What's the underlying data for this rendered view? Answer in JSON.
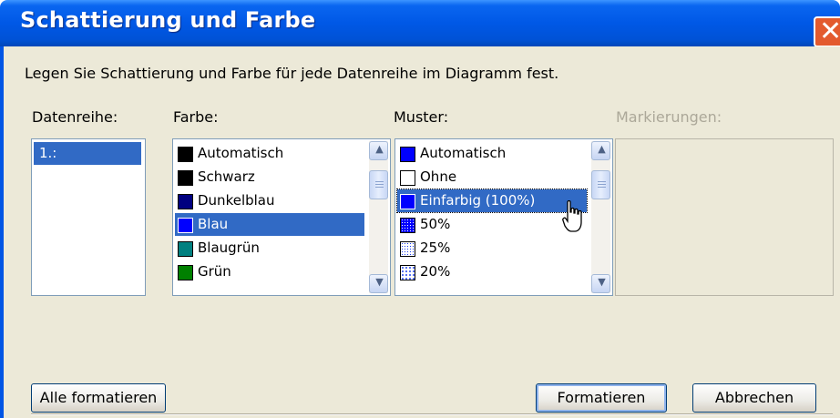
{
  "window": {
    "title": "Schattierung und Farbe"
  },
  "instruction": "Legen Sie Schattierung und Farbe für jede Datenreihe im Diagramm fest.",
  "labels": {
    "datenreihe": "Datenreihe:",
    "farbe": "Farbe:",
    "muster": "Muster:",
    "markierungen": "Markierungen:"
  },
  "datenreihe_items": [
    {
      "label": "1.:",
      "selected": true
    }
  ],
  "farbe_items": [
    {
      "label": "Automatisch",
      "color": "#000000"
    },
    {
      "label": "Schwarz",
      "color": "#000000"
    },
    {
      "label": "Dunkelblau",
      "color": "#000080"
    },
    {
      "label": "Blau",
      "color": "#0000ff",
      "selected": true
    },
    {
      "label": "Blaugrün",
      "color": "#008080"
    },
    {
      "label": "Grün",
      "color": "#008000"
    }
  ],
  "muster_items": [
    {
      "label": "Automatisch",
      "pattern": "solid-blue"
    },
    {
      "label": "Ohne",
      "pattern": "none"
    },
    {
      "label": "Einfarbig (100%)",
      "pattern": "solid-blue",
      "selected": true
    },
    {
      "label": "50%",
      "pattern": "dots-50"
    },
    {
      "label": "25%",
      "pattern": "dots-25"
    },
    {
      "label": "20%",
      "pattern": "dots-20"
    }
  ],
  "buttons": {
    "alle_formatieren": "Alle formatieren",
    "formatieren": "Formatieren",
    "abbrechen": "Abbrechen"
  },
  "colors": {
    "titlebar": "#0058e6",
    "selection": "#316ac5",
    "dialog_bg": "#ece9d8",
    "close": "#e35a2e"
  },
  "icons": [
    "close-icon",
    "scroll-up-icon",
    "scroll-down-icon",
    "mouse-pointer-icon"
  ]
}
